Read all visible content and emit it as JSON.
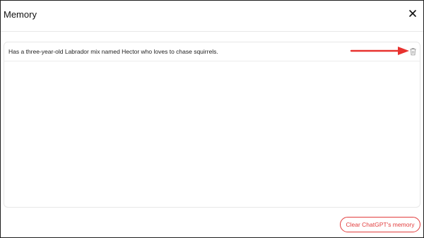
{
  "dialog": {
    "title": "Memory",
    "close_icon": "close-icon"
  },
  "memories": [
    {
      "text": "Has a three-year-old Labrador mix named Hector who loves to chase squirrels.",
      "delete_icon": "trash-icon"
    }
  ],
  "annotation": {
    "icon": "arrow-right-icon",
    "color": "#e8322f"
  },
  "footer": {
    "clear_label": "Clear ChatGPT's memory",
    "clear_color": "#e23c3c"
  }
}
